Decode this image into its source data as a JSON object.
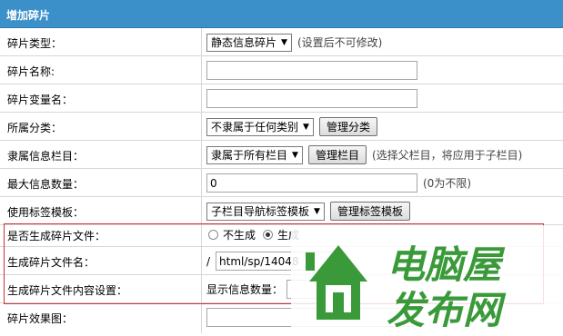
{
  "header": {
    "title": "增加碎片"
  },
  "rows": [
    {
      "label": "碎片类型：",
      "select": "静态信息碎片",
      "hint": "(设置后不可修改)"
    },
    {
      "label": "碎片名称:"
    },
    {
      "label": "碎片变量名："
    },
    {
      "label": "所属分类：",
      "select": "不隶属于任何类别",
      "button": "管理分类"
    },
    {
      "label": "隶属信息栏目：",
      "select": "隶属于所有栏目",
      "button": "管理栏目",
      "hint": "(选择父栏目，将应用于子栏目)"
    },
    {
      "label": "最大信息数量：",
      "input_value": "0",
      "hint": "(0为不限)"
    },
    {
      "label": "使用标签模板：",
      "select": "子栏目导航标签模板",
      "button": "管理标签模板"
    },
    {
      "label": "是否生成碎片文件：",
      "radio1": "不生成",
      "radio2": "生成"
    },
    {
      "label": "生成碎片文件名：",
      "prefix": "/",
      "input_value": "html/sp/14048"
    },
    {
      "label": "生成碎片文件内容设置：",
      "sub_label": "显示信息数量："
    },
    {
      "label": "碎片效果图："
    }
  ],
  "watermark": {
    "text": "电脑屋 发布网",
    "color": "#3a9a3a"
  }
}
